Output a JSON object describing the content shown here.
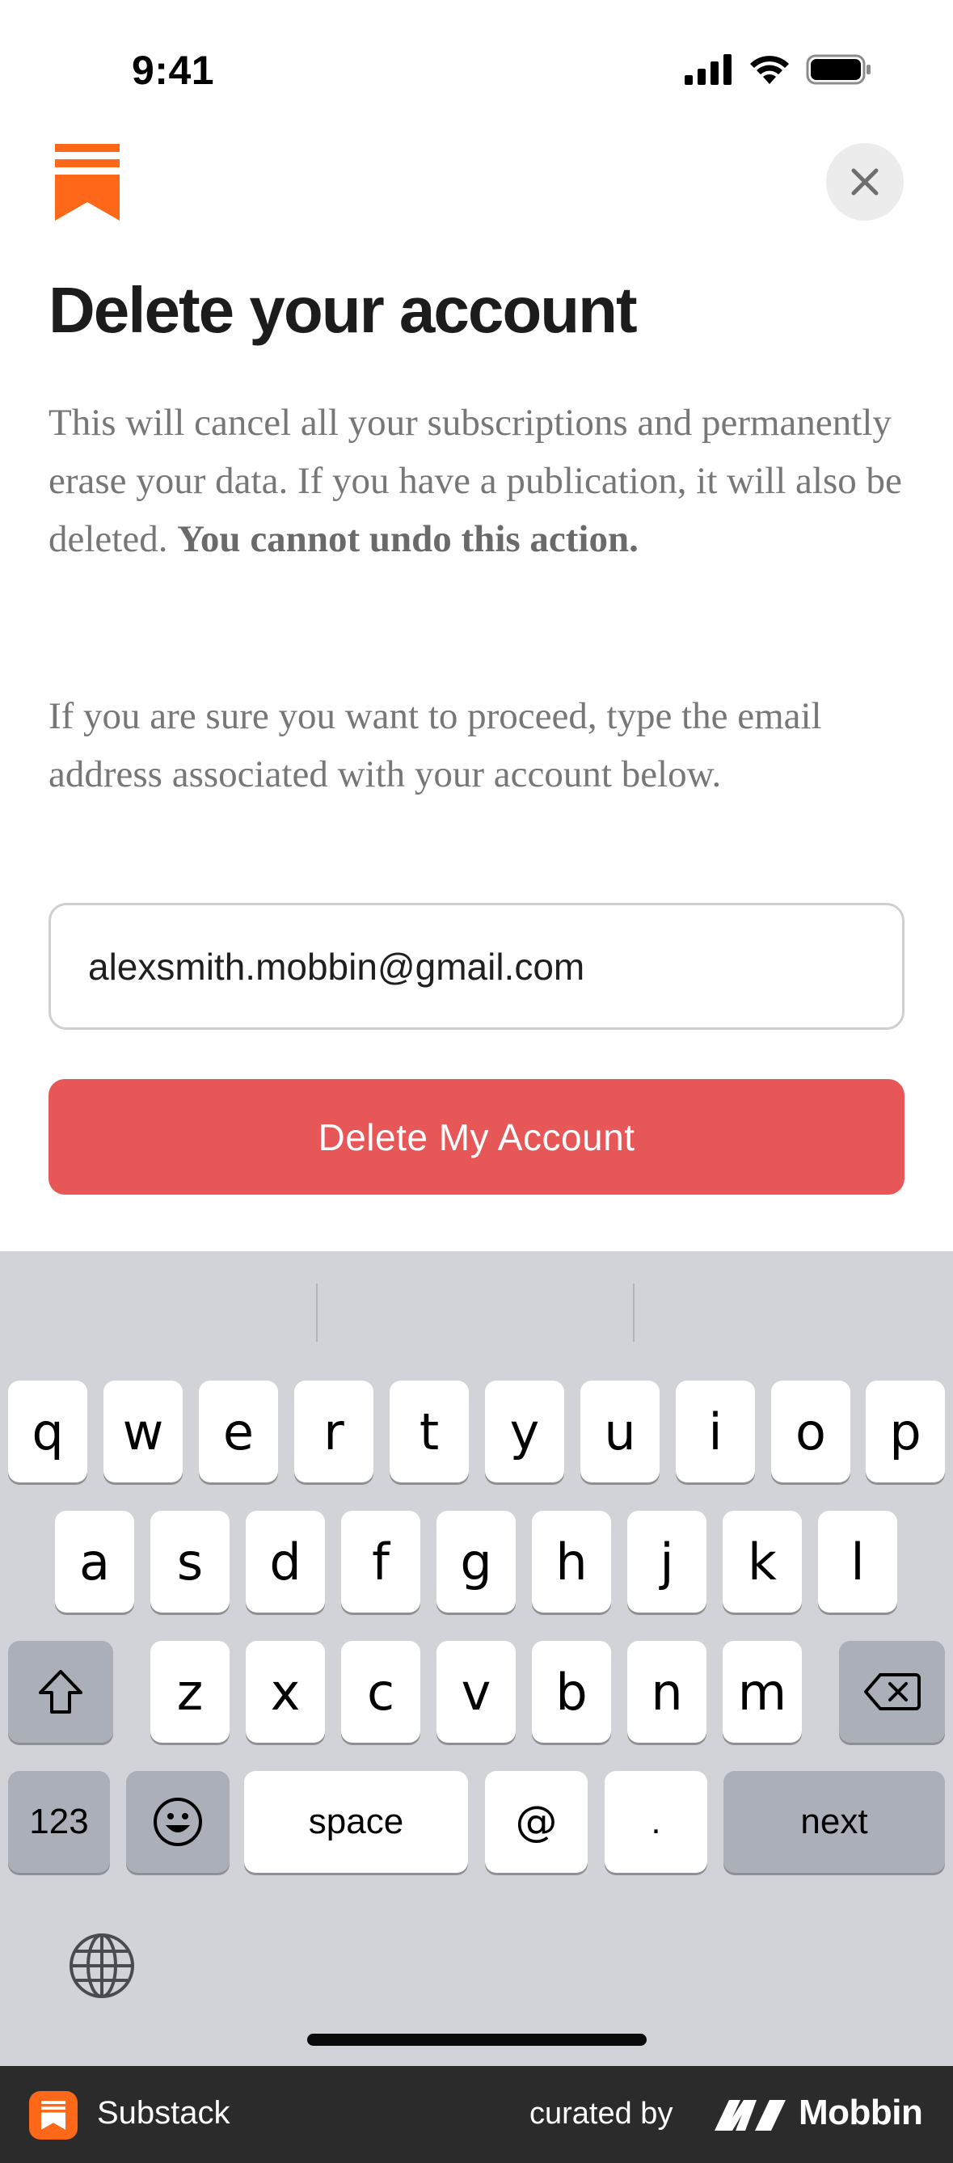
{
  "status_bar": {
    "time": "9:41"
  },
  "header": {
    "close_icon": "close-icon",
    "logo_icon": "substack-bookmark-logo"
  },
  "title": "Delete your account",
  "warning": {
    "text": "This will cancel all your subscriptions and permanently erase your data. If you have a publication, it will also be deleted. ",
    "bold": "You cannot undo this action."
  },
  "instruction": "If you are sure you want to proceed, type the email address associated with your account below.",
  "email_field": {
    "value": "alexsmith.mobbin@gmail.com"
  },
  "delete_button": {
    "label": "Delete My Account"
  },
  "keyboard": {
    "row1": [
      "q",
      "w",
      "e",
      "r",
      "t",
      "y",
      "u",
      "i",
      "o",
      "p"
    ],
    "row2": [
      "a",
      "s",
      "d",
      "f",
      "g",
      "h",
      "j",
      "k",
      "l"
    ],
    "row3": [
      "z",
      "x",
      "c",
      "v",
      "b",
      "n",
      "m"
    ],
    "numbers_label": "123",
    "space_label": "space",
    "at_label": "@",
    "dot_label": ".",
    "next_label": "next"
  },
  "footer": {
    "app_name": "Substack",
    "curated_by": "curated by",
    "brand": "Mobbin"
  },
  "colors": {
    "accent": "#ff6719",
    "danger": "#e85757",
    "keyboard_bg": "#d1d3d9",
    "footer_bg": "#2b2b2b"
  }
}
